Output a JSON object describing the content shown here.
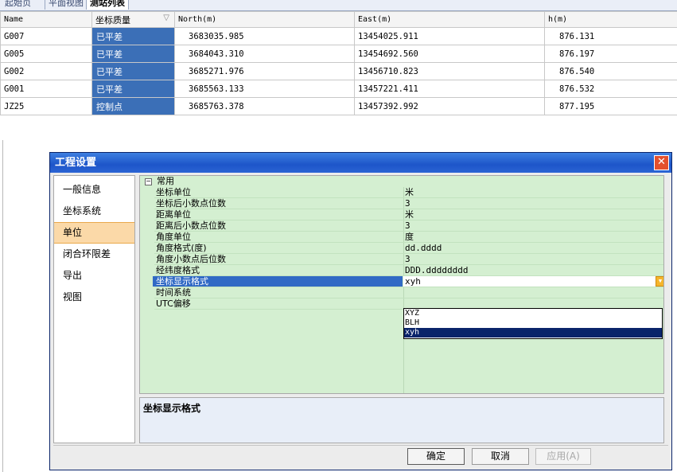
{
  "tabs": [
    "起始页",
    "平面视图",
    "测站列表"
  ],
  "table": {
    "headers": [
      "Name",
      "坐标质量",
      "North(m)",
      "East(m)",
      "h(m)"
    ],
    "rows": [
      {
        "name": "G007",
        "quality": "已平差",
        "north": "3683035.985",
        "east": "13454025.911",
        "h": "876.131"
      },
      {
        "name": "G005",
        "quality": "已平差",
        "north": "3684043.310",
        "east": "13454692.560",
        "h": "876.197"
      },
      {
        "name": "G002",
        "quality": "已平差",
        "north": "3685271.976",
        "east": "13456710.823",
        "h": "876.540"
      },
      {
        "name": "G001",
        "quality": "已平差",
        "north": "3685563.133",
        "east": "13457221.411",
        "h": "876.532"
      },
      {
        "name": "JZ25",
        "quality": "控制点",
        "north": "3685763.378",
        "east": "13457392.992",
        "h": "877.195"
      }
    ]
  },
  "dialog": {
    "title": "工程设置",
    "nav": [
      "一般信息",
      "坐标系统",
      "单位",
      "闭合环限差",
      "导出",
      "视图"
    ],
    "category": "常用",
    "properties": [
      {
        "key": "坐标单位",
        "value": "米"
      },
      {
        "key": "坐标后小数点位数",
        "value": "3"
      },
      {
        "key": "距离单位",
        "value": "米"
      },
      {
        "key": "距离后小数点位数",
        "value": "3"
      },
      {
        "key": "角度单位",
        "value": "度"
      },
      {
        "key": "角度格式(度)",
        "value": "dd.dddd"
      },
      {
        "key": "角度小数点后位数",
        "value": "3"
      },
      {
        "key": "经纬度格式",
        "value": "DDD.dddddddd"
      },
      {
        "key": "坐标显示格式",
        "value": "xyh"
      },
      {
        "key": "时间系统",
        "value": ""
      },
      {
        "key": "UTC偏移",
        "value": ""
      }
    ],
    "dropdown_options": [
      "XYZ",
      "BLH",
      "xyh"
    ],
    "description_title": "坐标显示格式",
    "buttons": {
      "ok": "确定",
      "cancel": "取消",
      "apply": "应用(A)"
    }
  },
  "colors": {
    "quality_cell": "#3b6fb7",
    "propgrid_bg": "#d4efd1",
    "selection": "#316ac5",
    "nav_selected": "#fbd9a8",
    "titlebar": "#1d55c9",
    "close_button": "#e4502d"
  },
  "icons": {
    "close": "close-icon",
    "sort": "sort-triangle-icon",
    "collapse": "collapse-box-icon",
    "combo": "chevron-down-icon"
  }
}
